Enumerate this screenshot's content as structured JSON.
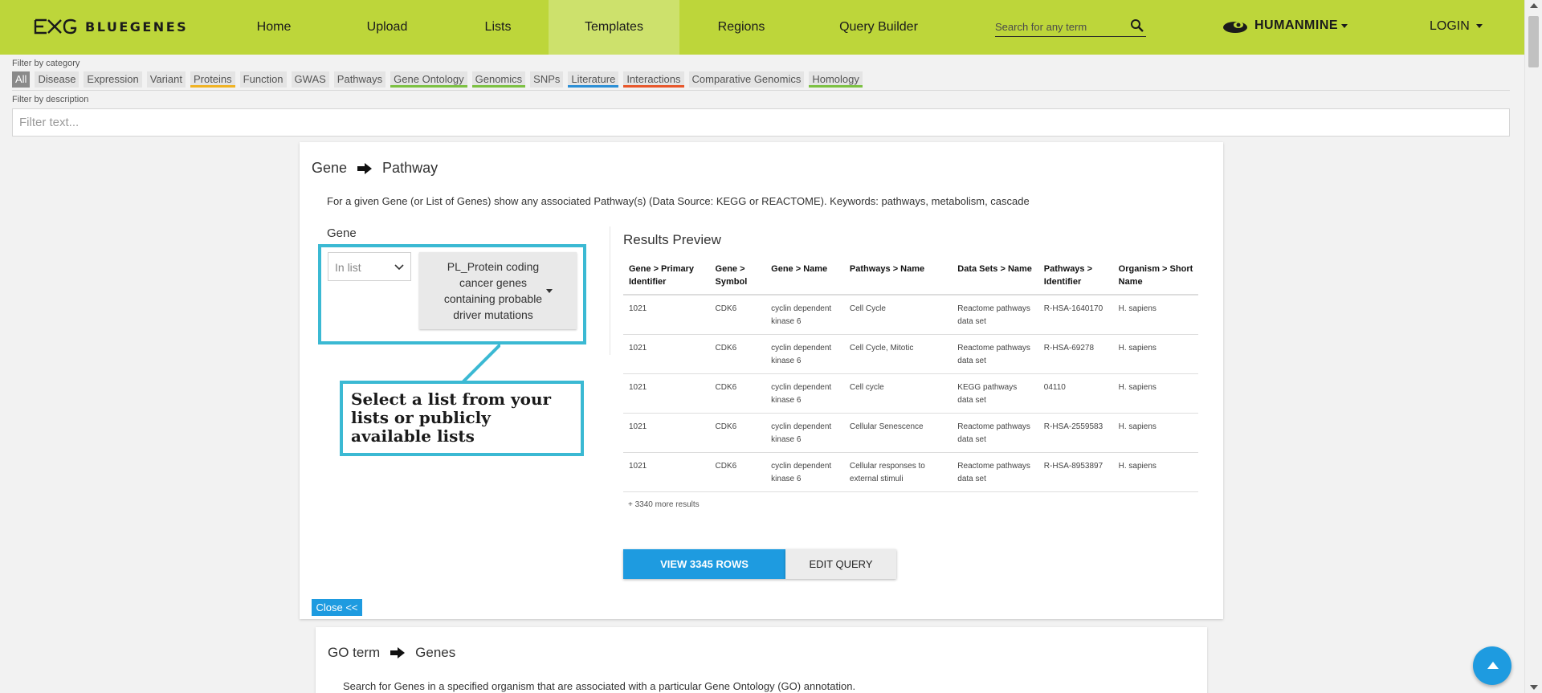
{
  "brand": {
    "name": "BLUEGENES"
  },
  "nav": {
    "items": [
      {
        "label": "Home"
      },
      {
        "label": "Upload"
      },
      {
        "label": "Lists"
      },
      {
        "label": "Templates"
      },
      {
        "label": "Regions"
      },
      {
        "label": "Query Builder"
      }
    ],
    "active": "Templates",
    "search_placeholder": "Search for any term",
    "mine": "HUMANMINE",
    "login": "LOGIN"
  },
  "filters": {
    "category_label": "Filter by category",
    "categories": [
      {
        "label": "All",
        "color": ""
      },
      {
        "label": "Disease",
        "color": ""
      },
      {
        "label": "Expression",
        "color": ""
      },
      {
        "label": "Variant",
        "color": ""
      },
      {
        "label": "Proteins",
        "color": "#f0b323"
      },
      {
        "label": "Function",
        "color": ""
      },
      {
        "label": "GWAS",
        "color": ""
      },
      {
        "label": "Pathways",
        "color": ""
      },
      {
        "label": "Gene Ontology",
        "color": "#7cc142"
      },
      {
        "label": "Genomics",
        "color": "#7cc142"
      },
      {
        "label": "SNPs",
        "color": ""
      },
      {
        "label": "Literature",
        "color": "#2b8fd6"
      },
      {
        "label": "Interactions",
        "color": "#e8562a"
      },
      {
        "label": "Comparative Genomics",
        "color": ""
      },
      {
        "label": "Homology",
        "color": "#7cc142"
      }
    ],
    "description_label": "Filter by description",
    "description_placeholder": "Filter text..."
  },
  "template": {
    "title_from": "Gene",
    "title_to": "Pathway",
    "description": "For a given Gene (or List of Genes) show any associated Pathway(s) (Data Source: KEGG or REACTOME). Keywords: pathways, metabolism, cascade",
    "gene_label": "Gene",
    "operator": "In list",
    "list_value": "PL_Protein coding cancer genes containing probable driver mutations",
    "callout": "Select a list from your lists or publicly available lists",
    "close": "Close <<"
  },
  "results": {
    "title": "Results Preview",
    "columns": [
      "Gene > Primary Identifier",
      "Gene > Symbol",
      "Gene > Name",
      "Pathways > Name",
      "Data Sets > Name",
      "Pathways > Identifier",
      "Organism > Short Name"
    ],
    "rows": [
      [
        "1021",
        "CDK6",
        "cyclin dependent kinase 6",
        "Cell Cycle",
        "Reactome pathways data set",
        "R-HSA-1640170",
        "H. sapiens"
      ],
      [
        "1021",
        "CDK6",
        "cyclin dependent kinase 6",
        "Cell Cycle, Mitotic",
        "Reactome pathways data set",
        "R-HSA-69278",
        "H. sapiens"
      ],
      [
        "1021",
        "CDK6",
        "cyclin dependent kinase 6",
        "Cell cycle",
        "KEGG pathways data set",
        "04110",
        "H. sapiens"
      ],
      [
        "1021",
        "CDK6",
        "cyclin dependent kinase 6",
        "Cellular Senescence",
        "Reactome pathways data set",
        "R-HSA-2559583",
        "H. sapiens"
      ],
      [
        "1021",
        "CDK6",
        "cyclin dependent kinase 6",
        "Cellular responses to external stimuli",
        "Reactome pathways data set",
        "R-HSA-8953897",
        "H. sapiens"
      ]
    ],
    "more": "+ 3340 more results",
    "view_button": "VIEW 3345 ROWS",
    "edit_button": "EDIT QUERY"
  },
  "next_template": {
    "title_from": "GO term",
    "title_to": "Genes",
    "description": "Search for Genes in a specified organism that are associated with a particular Gene Ontology (GO) annotation."
  },
  "colors": {
    "nav_bg": "#bdd63a",
    "nav_active": "#cde16c",
    "accent": "#1e9be0",
    "highlight": "#3bb9d3"
  }
}
